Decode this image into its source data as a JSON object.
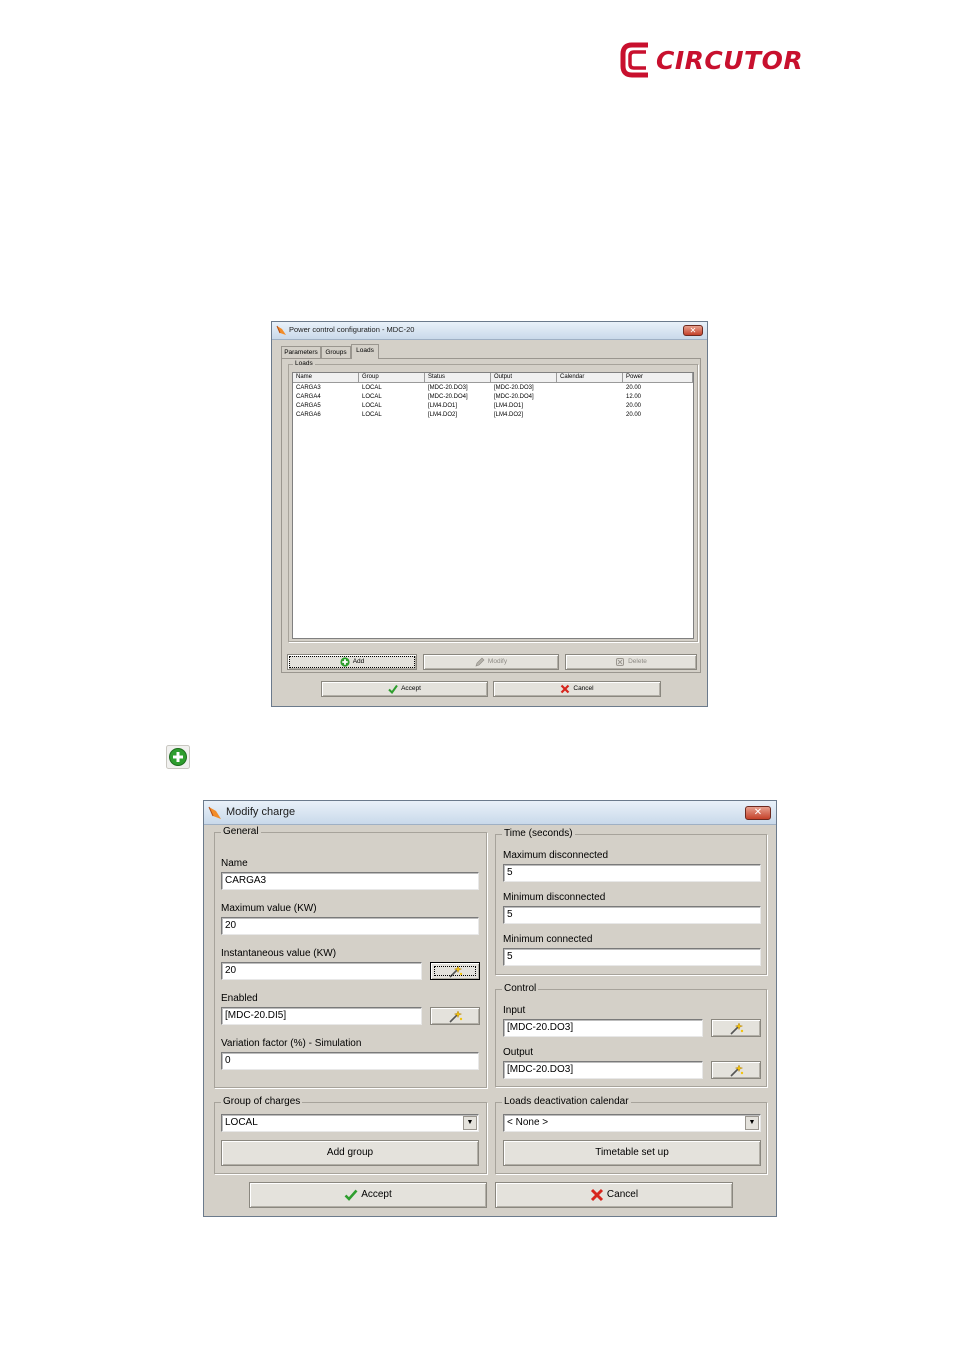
{
  "logo": {
    "brand": "CIRCUTOR",
    "brand_color": "#c8102e"
  },
  "power_window": {
    "title": "Power control configuration - MDC-20",
    "tabs": [
      {
        "label": "Parameters",
        "active": false
      },
      {
        "label": "Groups",
        "active": false
      },
      {
        "label": "Loads",
        "active": true
      }
    ],
    "loads_group_label": "Loads",
    "columns": [
      "Name",
      "Group",
      "Status",
      "Output",
      "Calendar",
      "Power"
    ],
    "rows": [
      [
        "CARGA3",
        "LOCAL",
        "[MDC-20.DO3]",
        "[MDC-20.DO3]",
        "",
        "20.00"
      ],
      [
        "CARGA4",
        "LOCAL",
        "[MDC-20.DO4]",
        "[MDC-20.DO4]",
        "",
        "12.00"
      ],
      [
        "CARGA5",
        "LOCAL",
        "[LM4.DO1]",
        "[LM4.DO1]",
        "",
        "20.00"
      ],
      [
        "CARGA6",
        "LOCAL",
        "[LM4.DO2]",
        "[LM4.DO2]",
        "",
        "20.00"
      ]
    ],
    "add_label": "Add",
    "modify_label": "Modify",
    "delete_label": "Delete",
    "accept_label": "Accept",
    "cancel_label": "Cancel"
  },
  "modify_window": {
    "title": "Modify charge",
    "general": {
      "legend": "General",
      "name_label": "Name",
      "name_value": "CARGA3",
      "max_label": "Maximum value (KW)",
      "max_value": "20",
      "inst_label": "Instantaneous value (KW)",
      "inst_value": "20",
      "enabled_label": "Enabled",
      "enabled_value": "[MDC-20.DI5]",
      "variation_label": "Variation factor (%) - Simulation",
      "variation_value": "0"
    },
    "time": {
      "legend": "Time (seconds)",
      "max_disc_label": "Maximum disconnected",
      "max_disc_value": "5",
      "min_disc_label": "Minimum disconnected",
      "min_disc_value": "5",
      "min_conn_label": "Minimum connected",
      "min_conn_value": "5"
    },
    "control": {
      "legend": "Control",
      "input_label": "Input",
      "input_value": "[MDC-20.DO3]",
      "output_label": "Output",
      "output_value": "[MDC-20.DO3]"
    },
    "group": {
      "legend": "Group of charges",
      "selected": "LOCAL",
      "add_group_label": "Add group"
    },
    "calendar": {
      "legend": "Loads deactivation calendar",
      "selected": "< None >",
      "timetable_label": "Timetable set up"
    },
    "accept_label": "Accept",
    "cancel_label": "Cancel"
  },
  "colors": {
    "accent_green": "#2e9e2e",
    "cancel_red": "#d7261e",
    "dialog_bg": "#d4d0c8"
  }
}
